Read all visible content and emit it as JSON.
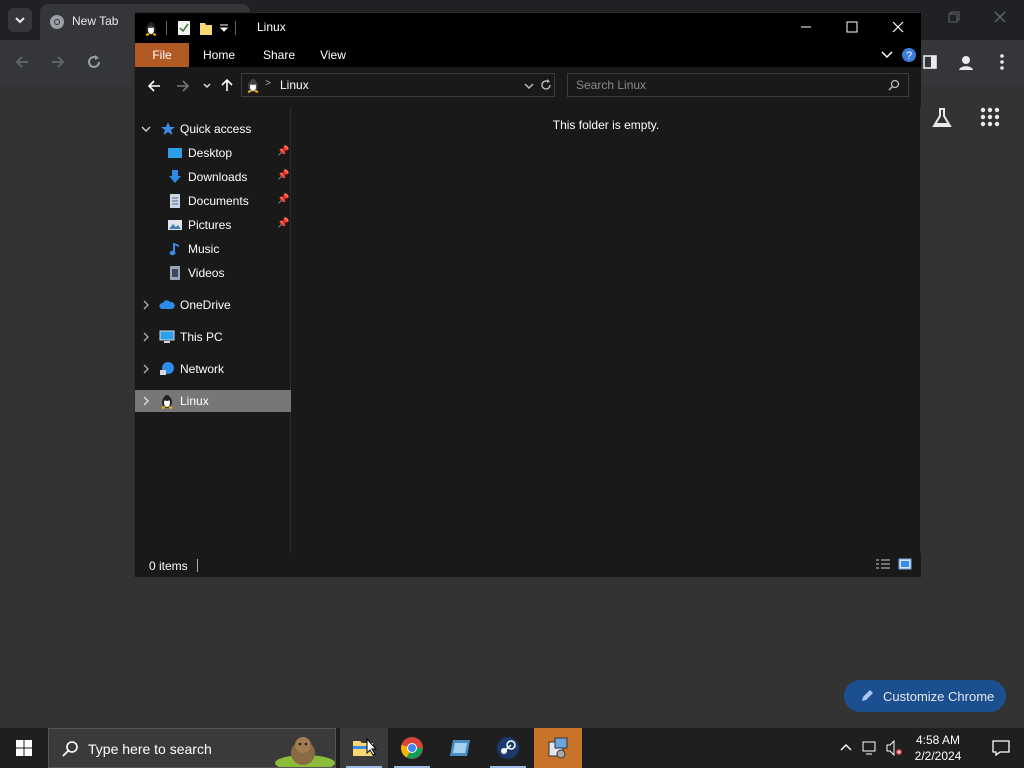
{
  "chrome": {
    "tab_title": "New Tab",
    "customize_label": "Customize Chrome"
  },
  "explorer": {
    "window_title": "Linux",
    "ribbon": {
      "file": "File",
      "home": "Home",
      "share": "Share",
      "view": "View"
    },
    "address": {
      "current": "Linux",
      "separator": ">"
    },
    "search": {
      "placeholder": "Search Linux"
    },
    "nav": {
      "quick_access": "Quick access",
      "quick_items": [
        {
          "label": "Desktop",
          "pinned": true
        },
        {
          "label": "Downloads",
          "pinned": true
        },
        {
          "label": "Documents",
          "pinned": true
        },
        {
          "label": "Pictures",
          "pinned": true
        },
        {
          "label": "Music",
          "pinned": false
        },
        {
          "label": "Videos",
          "pinned": false
        }
      ],
      "onedrive": "OneDrive",
      "this_pc": "This PC",
      "network": "Network",
      "linux": "Linux"
    },
    "empty_message": "This folder is empty.",
    "status": {
      "items": "0 items"
    }
  },
  "taskbar": {
    "search_placeholder": "Type here to search",
    "time": "4:58 AM",
    "date": "2/2/2024"
  },
  "colors": {
    "file_tab": "#b25a23",
    "selected_nav": "#777777",
    "customize_button": "#1c4f8f",
    "taskbar_active": "#c8732a"
  }
}
